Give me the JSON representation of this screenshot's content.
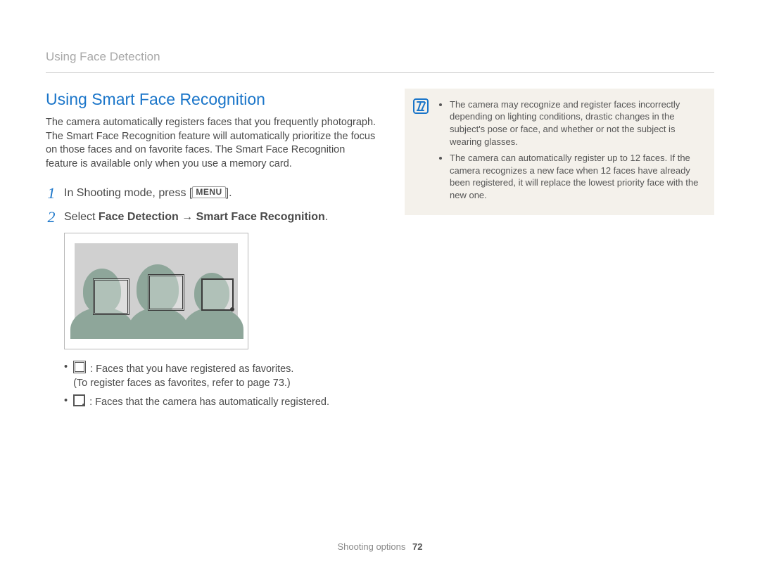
{
  "header": {
    "breadcrumb": "Using Face Detection"
  },
  "content": {
    "title": "Using Smart Face Recognition",
    "intro": "The camera automatically registers faces that you frequently photograph. The Smart Face Recognition feature will automatically prioritize the focus on those faces and on favorite faces. The Smart Face Recognition feature is available only when you use a memory card.",
    "steps": {
      "s1_num": "1",
      "s1_prefix": "In Shooting mode, press [",
      "s1_menu": "MENU",
      "s1_suffix": "].",
      "s2_num": "2",
      "s2_prefix": "Select ",
      "s2_strong1": "Face Detection",
      "s2_arrow": " → ",
      "s2_strong2": "Smart Face Recognition",
      "s2_suffix": "."
    },
    "legend": {
      "fav_text": " : Faces that you have registered as favorites.",
      "fav_sub": "(To register faces as favorites, refer to page 73.)",
      "auto_text": " : Faces that the camera has automatically registered."
    }
  },
  "notes": {
    "n1": "The camera may recognize and register faces incorrectly depending on lighting conditions, drastic changes in the subject's pose or face, and whether or not the subject is wearing glasses.",
    "n2": "The camera can automatically register up to 12 faces. If the camera recognizes a new face when 12 faces have already been registered, it will replace the lowest priority face with the new one."
  },
  "footer": {
    "section": "Shooting options",
    "page": "72"
  }
}
